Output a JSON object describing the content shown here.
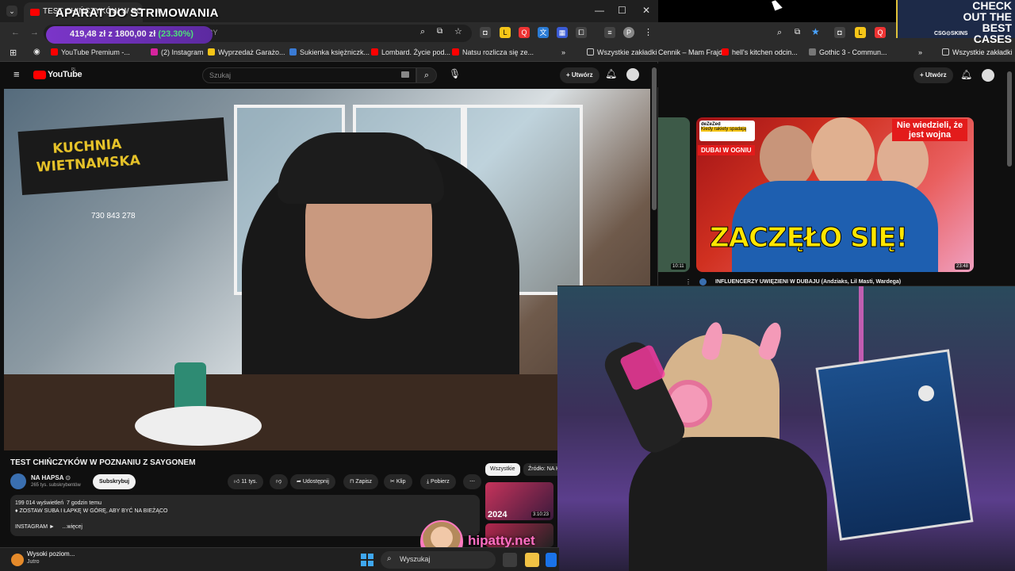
{
  "overlay": {
    "title": "APARAT DO STRIMOWANIA",
    "donation_amount": "419,48 zł",
    "donation_goal": "z 1800,00 zł",
    "donation_pct": "(23.30%)",
    "url_fragment": "bAggscfBY"
  },
  "left_browser": {
    "tab_title": "TEST CHIŃCZYKÓW W PO",
    "window_controls": {
      "minimize": "—",
      "maximize": "☐",
      "close": "✕"
    },
    "bookmarks": [
      {
        "label": "YouTube Premium -...",
        "color": "#ff0000"
      },
      {
        "label": "(2) Instagram",
        "color": "#d6249f"
      },
      {
        "label": "Wyprzedaż Garażo...",
        "color": "#f5c518"
      },
      {
        "label": "Sukienka księżniczk...",
        "color": "#3a7bd5"
      },
      {
        "label": "Lombard. Życie pod...",
        "color": "#ff0000"
      },
      {
        "label": "Natsu rozlicza się ze...",
        "color": "#ff0000"
      }
    ],
    "bookmarks_more": "»",
    "all_bookmarks": "Wszystkie zakładki"
  },
  "youtube": {
    "logo": "YouTube",
    "logo_region": "PL",
    "search_placeholder": "Szukaj",
    "create_label": "Utwórz",
    "video": {
      "sign_text": "KUCHNIA\nWIETNAMSKA",
      "phone_text": "730 843 278",
      "title": "TEST CHIŃCZYKÓW W POZNANIU Z SAYGONEM",
      "channel": "NA HAPSA",
      "subscribers": "265 tys. subskrybentów",
      "subscribe_label": "Subskrybuj",
      "likes": "11 tys.",
      "share_label": "Udostępnij",
      "save_label": "Zapisz",
      "clip_label": "Klip",
      "download_label": "Pobierz",
      "more_label": "⋯",
      "views": "199 014 wyświetleń",
      "age": "7 godzin temu",
      "desc_line": "♦ ZOSTAW SUBA I ŁAPKĘ W GÓRĘ, ABY BYĆ NA BIEŻĄCO",
      "instagram": "INSTAGRAM ►",
      "more_desc": "...więcej"
    },
    "chips": [
      "Wszystkie",
      "Źródło: NA H"
    ],
    "recommended": {
      "year": "2024",
      "duration": "3:10:23"
    }
  },
  "right_browser": {
    "bookmarks": [
      {
        "label": "Cennik – Mam Frajd...",
        "color": "#ff0000"
      },
      {
        "label": "hell's kitchen odcin...",
        "color": "#ff0000"
      },
      {
        "label": "Gothic 3 - Commun...",
        "color": "#777777"
      }
    ],
    "all_bookmarks": "Wszystkie zakładki",
    "create_label": "Utwórz",
    "ad": {
      "title": "CHECK OUT THE BEST CASES",
      "brand": "CSG⊙SKINS"
    },
    "thumb": {
      "headline": "ZACZĘŁO SIĘ!",
      "badge": "Nie wiedzieli, że jest wojna",
      "dubai": "DUBAI W OGNIU",
      "tweet_name": "deZeZed",
      "tweet_text": "Kiedy rakiety spadają",
      "duration": "23:48",
      "side_duration": "10:11",
      "video_title": "INFLUENCERZY UWIĘZIENI W DUBAJU (Andziaks, Lil Masti, Wardega)"
    }
  },
  "watermark": {
    "text": "hipatty.net"
  },
  "taskbar": {
    "notif_title": "Wysoki poziom...",
    "notif_sub": "Jutro",
    "search_label": "Wyszukaj"
  }
}
